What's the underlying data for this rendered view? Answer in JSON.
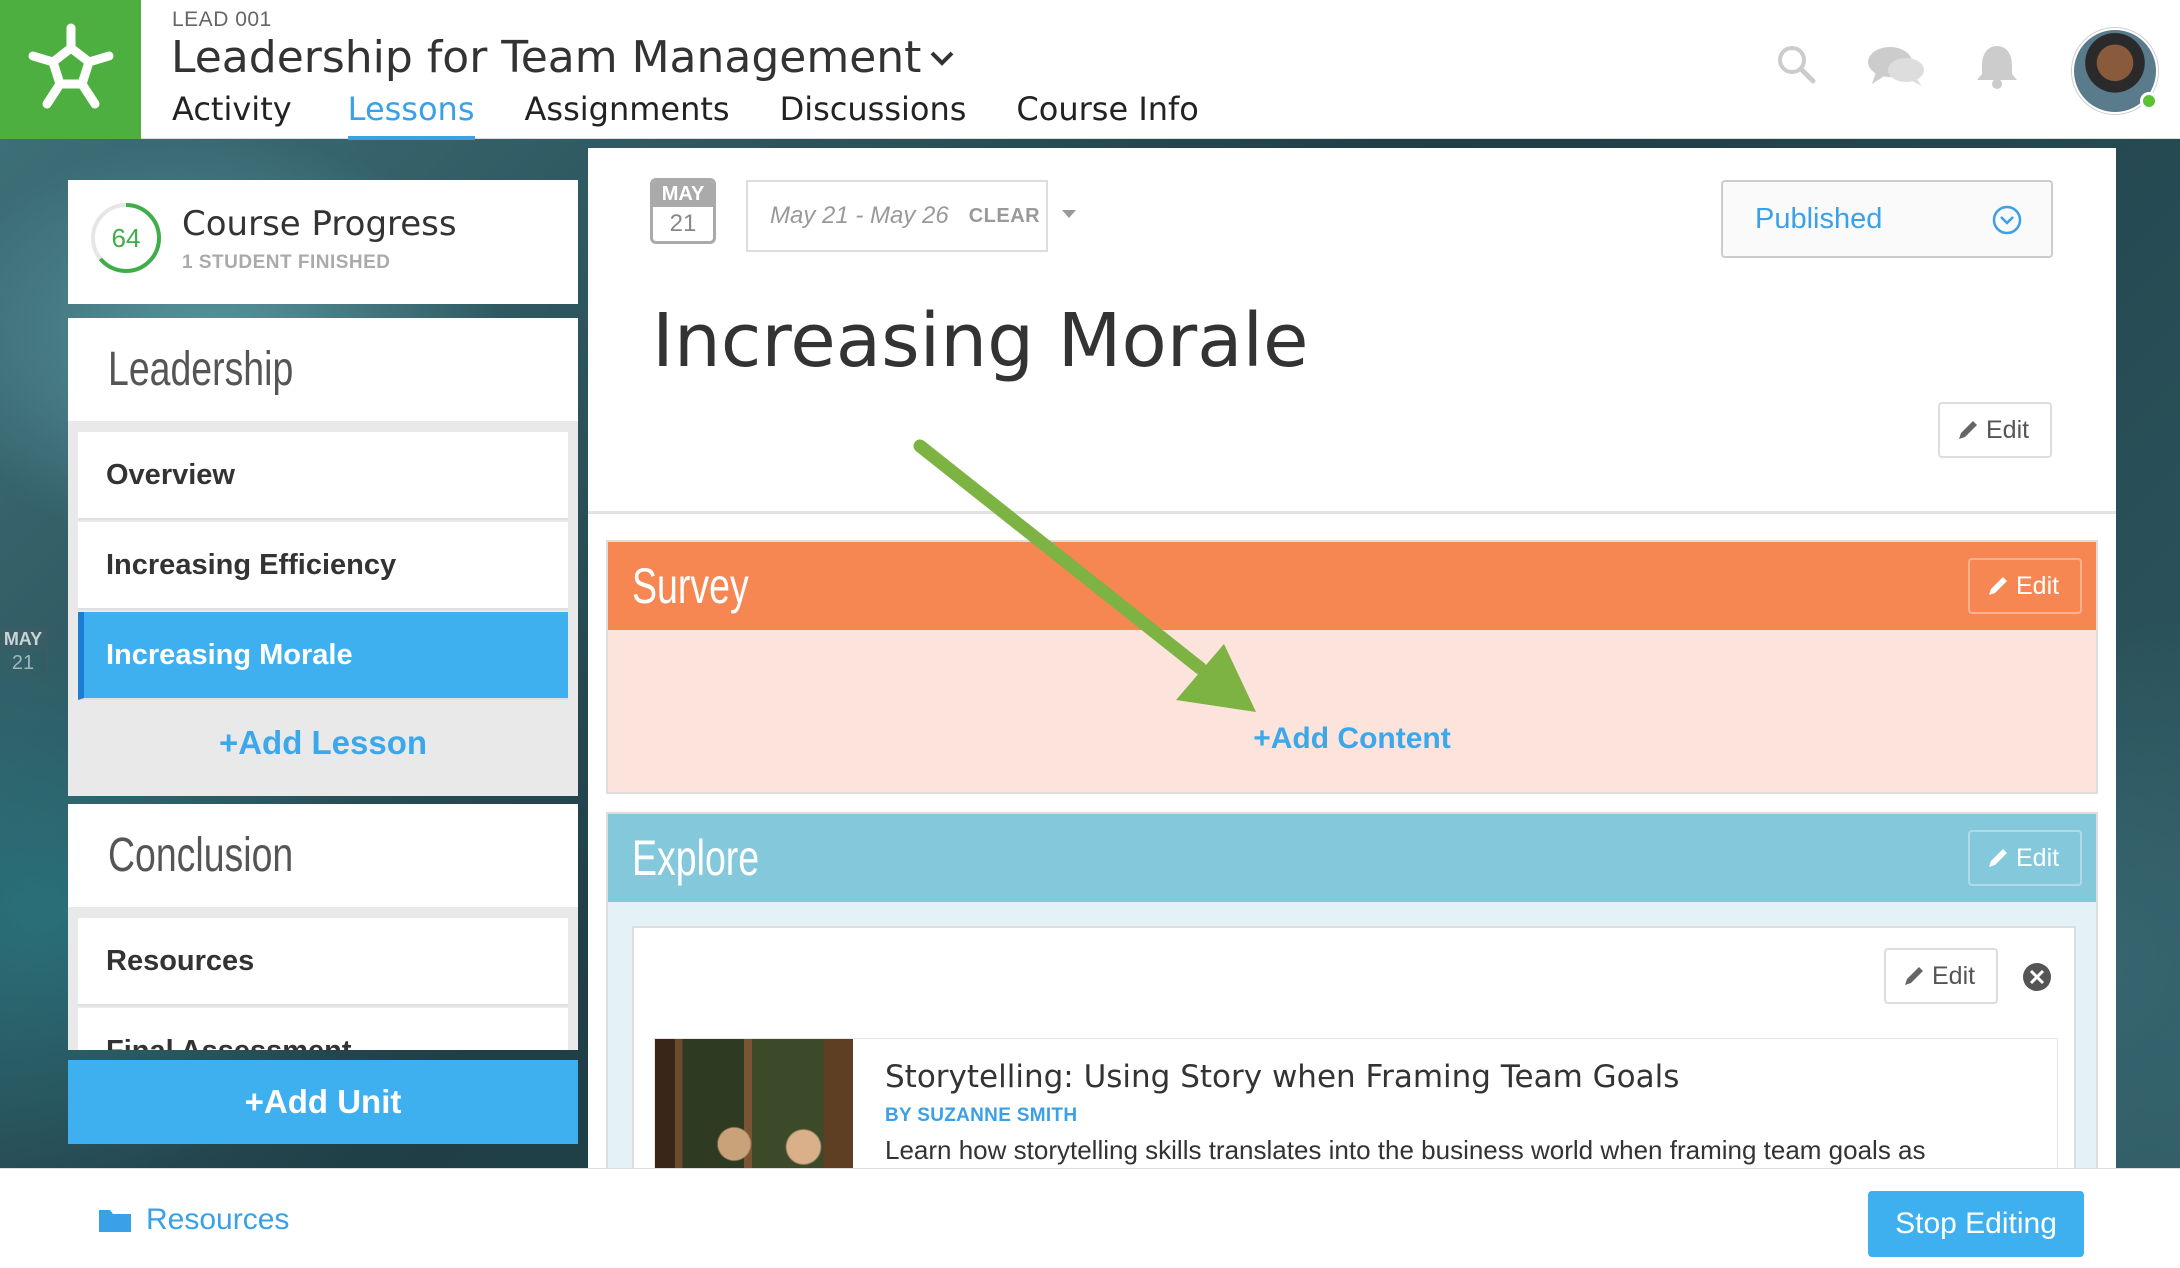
{
  "header": {
    "course_code": "LEAD 001",
    "course_title": "Leadership for Team Management",
    "tabs": [
      {
        "label": "Activity",
        "active": false
      },
      {
        "label": "Lessons",
        "active": true
      },
      {
        "label": "Assignments",
        "active": false
      },
      {
        "label": "Discussions",
        "active": false
      },
      {
        "label": "Course Info",
        "active": false
      }
    ],
    "icons": [
      "search-icon",
      "chat-icon",
      "bell-icon"
    ],
    "brand_color": "#4caf3f",
    "accent_color": "#3aa0e8"
  },
  "sidebar": {
    "progress": {
      "value": "64",
      "title": "Course Progress",
      "subtitle": "1 STUDENT FINISHED"
    },
    "date": {
      "month": "MAY",
      "day": "21"
    },
    "units": [
      {
        "title": "Leadership",
        "lessons": [
          {
            "label": "Overview",
            "active": false
          },
          {
            "label": "Increasing Efficiency",
            "active": false
          },
          {
            "label": "Increasing Morale",
            "active": true
          }
        ],
        "add_lesson": "+Add Lesson"
      },
      {
        "title": "Conclusion",
        "lessons": [
          {
            "label": "Resources",
            "active": false
          },
          {
            "label": "Final Assessment",
            "active": false
          }
        ]
      }
    ],
    "add_unit": "+Add Unit"
  },
  "main": {
    "date_badge": {
      "month": "MAY",
      "day": "21"
    },
    "date_range": "May 21 - May 26",
    "clear_label": "CLEAR",
    "status": "Published",
    "lesson_title": "Increasing Morale",
    "edit_label": "Edit",
    "sections": [
      {
        "title": "Survey",
        "color": "#f68753",
        "add_content": "+Add Content"
      },
      {
        "title": "Explore",
        "color": "#84c8dc"
      }
    ],
    "article": {
      "title": "Storytelling: Using Story when Framing Team Goals",
      "author": "BY SUZANNE SMITH",
      "description": "Learn how storytelling skills translates into the business world when framing team goals as"
    }
  },
  "footer": {
    "resources_label": "Resources",
    "stop_editing_label": "Stop Editing"
  }
}
